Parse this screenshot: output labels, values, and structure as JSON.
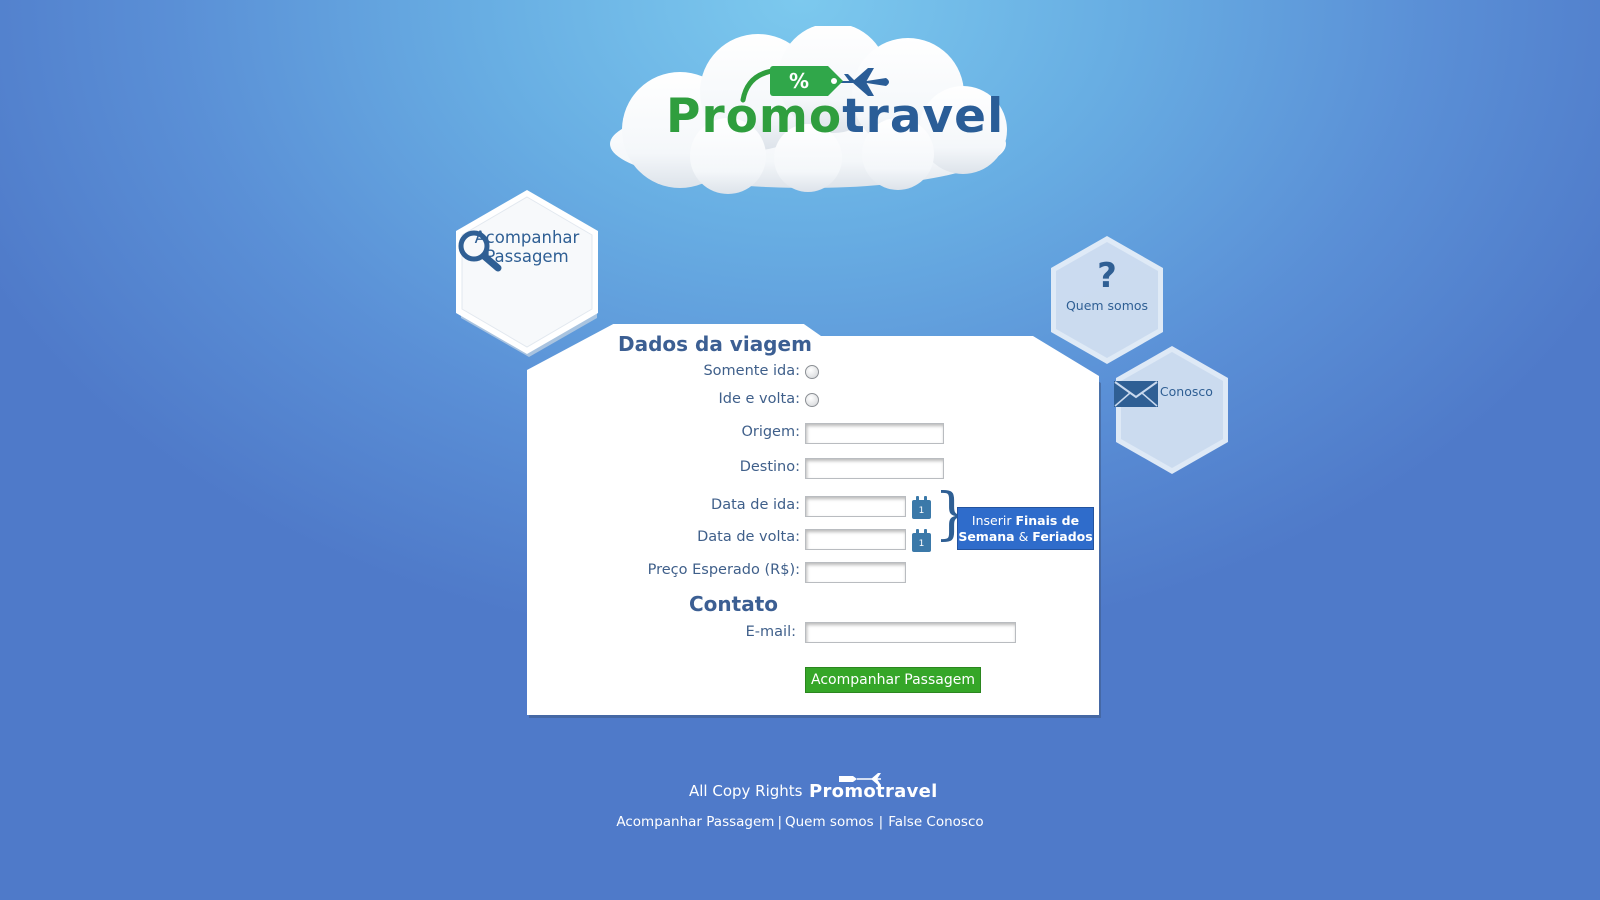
{
  "brand": {
    "part1": "Promo",
    "part2": "travel",
    "tag_symbol": "%"
  },
  "nav": {
    "track": {
      "line1": "Acompanhar",
      "line2": "Passagem"
    },
    "about": {
      "label": "Quem somos",
      "icon": "question-icon"
    },
    "contact": {
      "label": "Fale Conosco",
      "icon": "envelope-icon"
    }
  },
  "form": {
    "title": "Dados da viagem",
    "one_way_label": "Somente ida:",
    "round_trip_label": "Ide e volta:",
    "origin_label": "Origem:",
    "destination_label": "Destino:",
    "depart_label": "Data de ida:",
    "return_label": "Data de volta:",
    "price_label": "Preço Esperado (R$):",
    "calendar_day": "1",
    "weekend_button": {
      "prefix": "Inserir ",
      "bold1": "Finais de",
      "bold2": "Semana",
      "amp": " & ",
      "bold3": "Feriados"
    },
    "contact_title": "Contato",
    "email_label": "E-mail:",
    "submit_label": "Acompanhar Passagem",
    "values": {
      "origin": "",
      "destination": "",
      "depart": "",
      "return": "",
      "price": "",
      "email": ""
    }
  },
  "footer": {
    "copyright": "All Copy Rights",
    "logo_text": "Promotravel",
    "links": [
      "Acompanhar Passagem",
      "Quem somos",
      "False Conosco"
    ],
    "separator": "|"
  },
  "colors": {
    "green": "#35a628",
    "blue_text": "#2f5f94",
    "button_blue": "#2f6ccb"
  }
}
